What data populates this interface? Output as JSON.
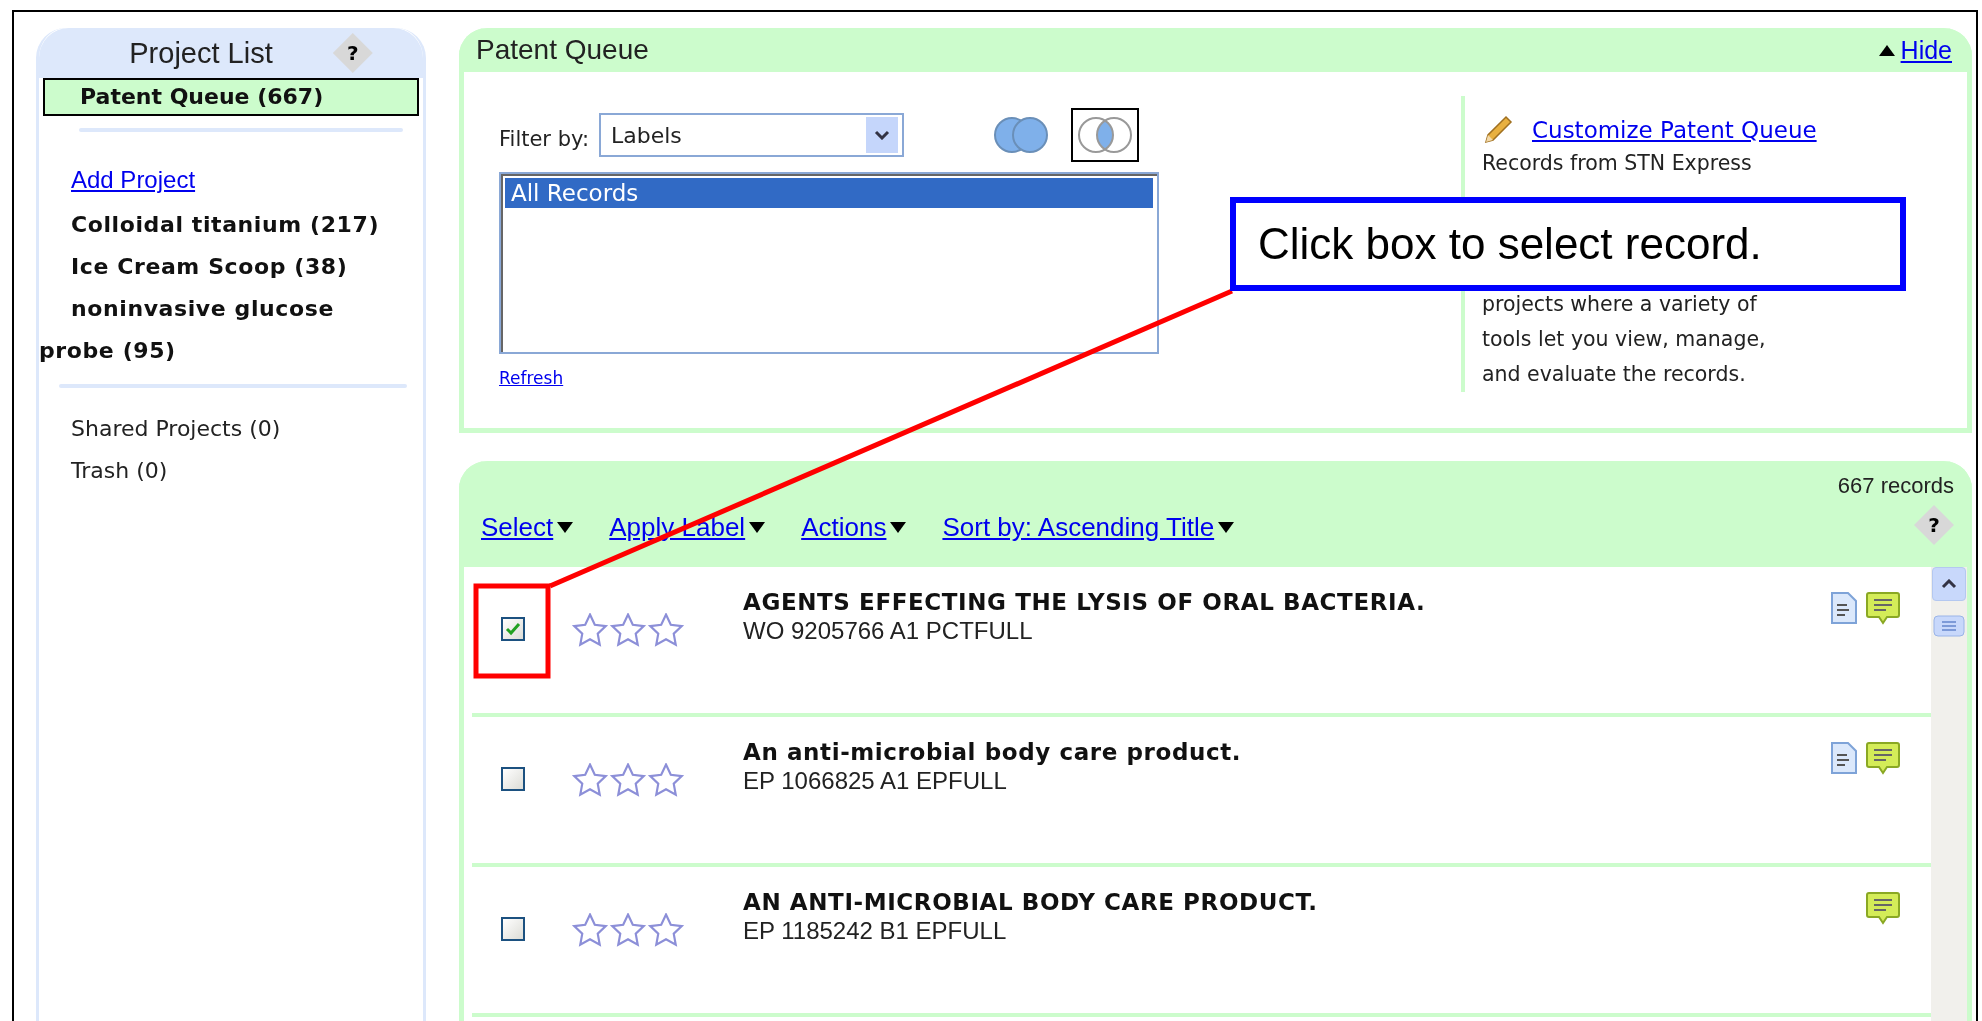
{
  "project_list": {
    "title": "Project List",
    "help": "?",
    "items": [
      {
        "label": "Patent Queue (667)",
        "selected": true
      }
    ],
    "add_project": "Add Project",
    "projects": [
      "Colloidal titanium (217)",
      "Ice Cream Scoop (38)",
      "noninvasive glucose probe (95)"
    ],
    "other": [
      "Shared Projects (0)",
      "Trash (0)"
    ]
  },
  "queue_panel": {
    "title": "Patent Queue",
    "hide": "Hide",
    "filter_label": "Filter by:",
    "filter_value": "Labels",
    "venn": [
      {
        "kind": "union",
        "selected": false
      },
      {
        "kind": "intersection",
        "selected": true
      }
    ],
    "label_list": [
      {
        "label": "All Records",
        "selected": true
      }
    ],
    "refresh": "Refresh",
    "customize": "Customize Patent Queue",
    "description_top": "Records from STN Express",
    "description_bottom": "projects where a variety of tools let you view, manage, and evaluate the records."
  },
  "records": {
    "count": "667 records",
    "help": "?",
    "menus": [
      "Select",
      "Apply Label",
      "Actions",
      "Sort by: Ascending Title"
    ],
    "rows": [
      {
        "title": "AGENTS EFFECTING THE LYSIS OF ORAL BACTERIA.",
        "id": "WO 9205766 A1 PCTFULL",
        "checked": true,
        "stars": 0,
        "document_icon": true,
        "comment_icon": true
      },
      {
        "title": "An anti-microbial body care product.",
        "id": "EP 1066825 A1 EPFULL",
        "checked": false,
        "stars": 0,
        "document_icon": true,
        "comment_icon": true
      },
      {
        "title": "AN ANTI-MICROBIAL BODY CARE PRODUCT.",
        "id": "EP 1185242 B1 EPFULL",
        "checked": false,
        "stars": 0,
        "document_icon": false,
        "comment_icon": true
      }
    ]
  },
  "callout": {
    "text": "Click box to select record."
  }
}
